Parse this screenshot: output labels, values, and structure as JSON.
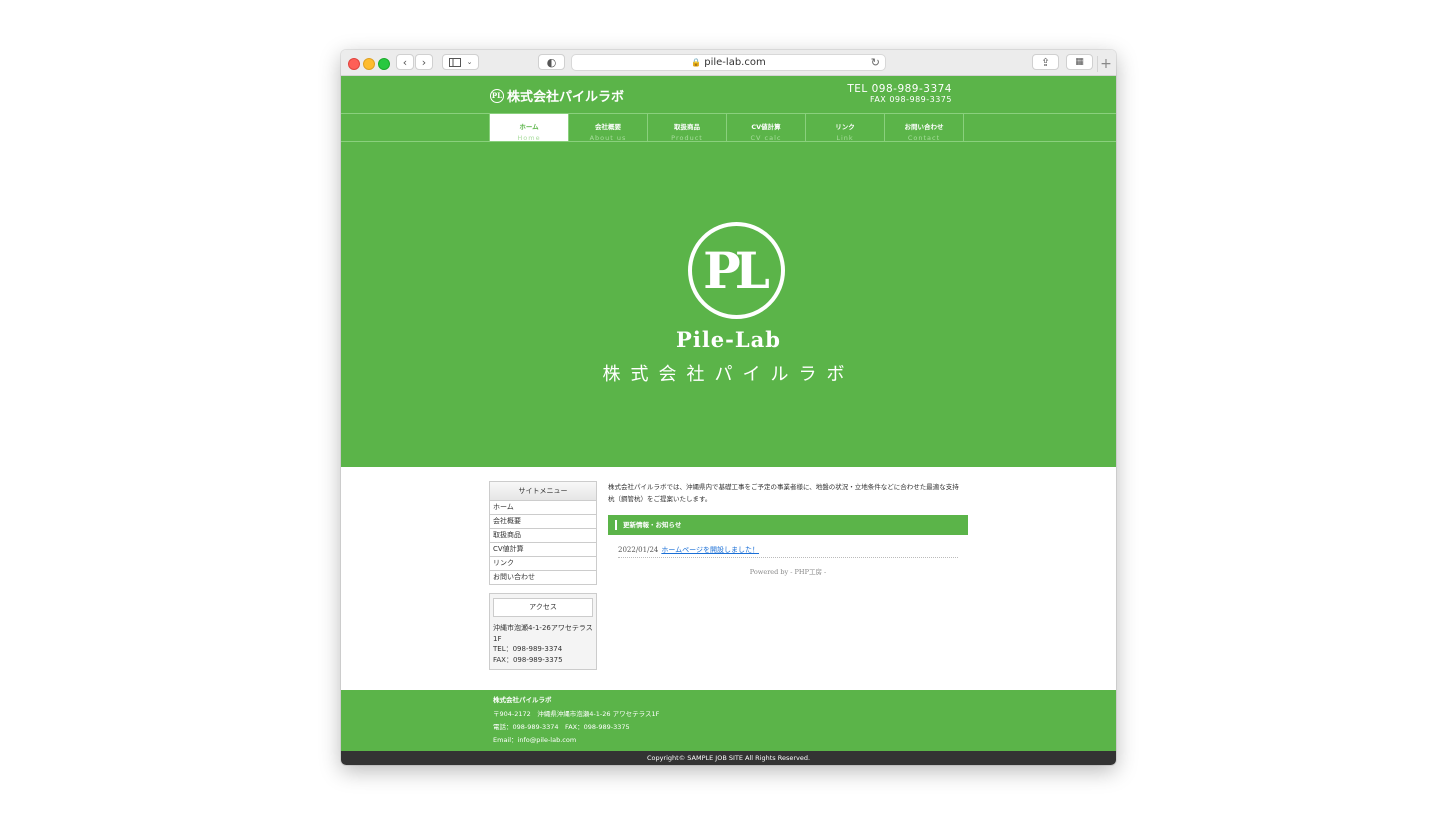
{
  "browser": {
    "url": "pile-lab.com",
    "back": "‹",
    "forward": "›",
    "sidebar_icon": "sidebar-icon",
    "shield": "◐",
    "share": "⇪",
    "tabs_icon": "▦",
    "plus": "+",
    "reload": "↻"
  },
  "header": {
    "logo_mark": "PL",
    "logo_text": "株式会社パイルラボ",
    "tel": "TEL 098-989-3374",
    "fax": "FAX 098-989-3375"
  },
  "nav": [
    {
      "jp": "ホーム",
      "en": "Home"
    },
    {
      "jp": "会社概要",
      "en": "About us"
    },
    {
      "jp": "取扱商品",
      "en": "Product"
    },
    {
      "jp": "CV値計算",
      "en": "CV calc"
    },
    {
      "jp": "リンク",
      "en": "Link"
    },
    {
      "jp": "お問い合わせ",
      "en": "Contact"
    }
  ],
  "hero": {
    "mark": "PL",
    "brand_en": "Pile-Lab",
    "brand_jp": "株式会社パイルラボ"
  },
  "sidebar": {
    "menu_title": "サイトメニュー",
    "menu": [
      "ホーム",
      "会社概要",
      "取扱商品",
      "CV値計算",
      "リンク",
      "お問い合わせ"
    ],
    "access_title": "アクセス",
    "access_lines": [
      "沖縄市泡瀬4-1-26アワセテラス",
      "1F",
      "TEL：098-989-3374",
      "FAX：098-989-3375"
    ]
  },
  "main": {
    "intro_1": "株式会社パイルラボでは、沖縄県内で基礎工事をご予定の事業者様に、地盤の状況・立地条件などに合わせた最適な支持",
    "intro_2": "杭（鋼管杭）をご提案いたします。",
    "news_title": "更新情報・お知らせ",
    "news_date": "2022/01/24",
    "news_link": "ホームページを開設しました！",
    "powered": "Powered by - PHP工房 -"
  },
  "footer": {
    "company": "株式会社パイルラボ",
    "address": "〒904-2172　沖縄県沖縄市泡瀬4-1-26 アワセテラス1F",
    "phone": "電話：098-989-3374　FAX：098-989-3375",
    "email": "Email：info@pile-lab.com",
    "copyright": "Copyright© SAMPLE JOB SITE All Rights Reserved."
  },
  "colors": {
    "brand_green": "#5bb449",
    "footer_dark": "#333333",
    "link_blue": "#1a6fd6"
  }
}
